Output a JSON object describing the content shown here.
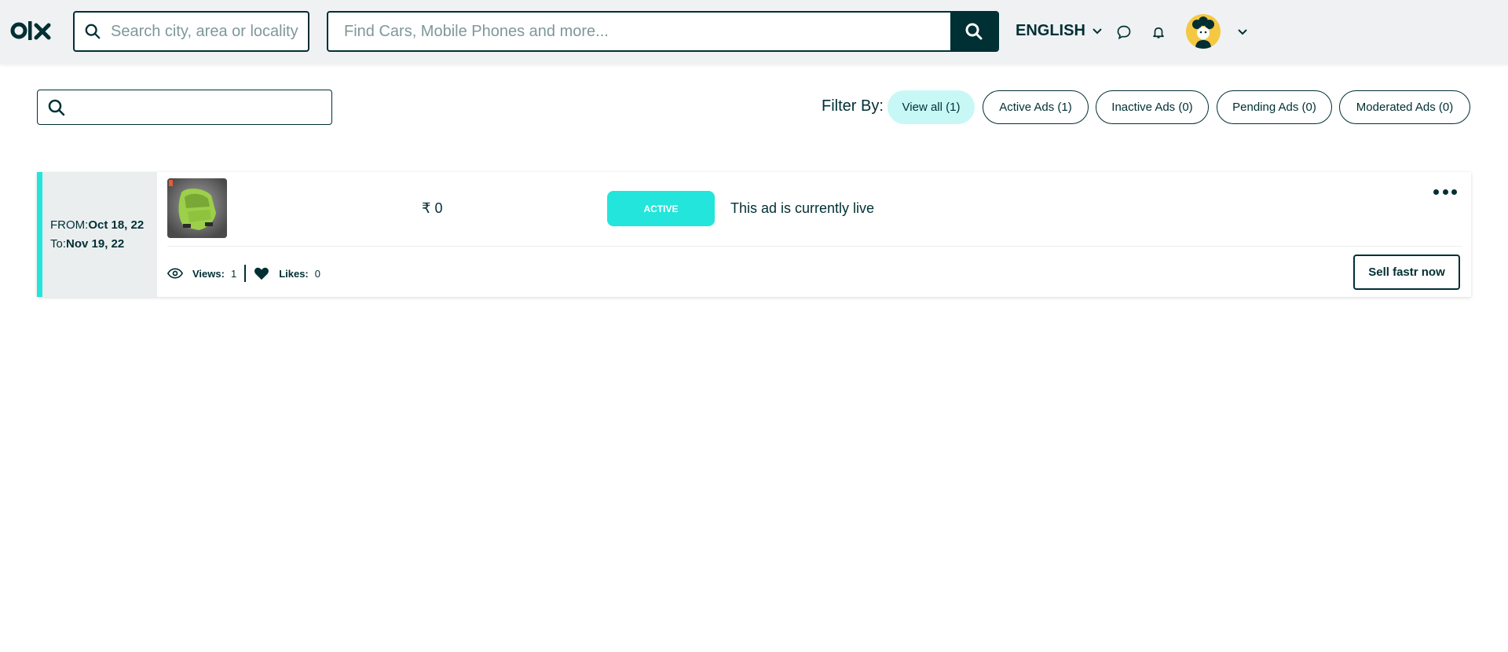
{
  "header": {
    "logo_text": "OLX",
    "location_placeholder": "Search city, area or locality",
    "search_placeholder": "Find Cars, Mobile Phones and more...",
    "language": "ENGLISH",
    "icons": [
      "search-icon",
      "chat-icon",
      "bell-icon",
      "chevron-down-icon"
    ]
  },
  "toolbar": {
    "search_placeholder": "",
    "filter_label": "Filter By:",
    "filters": [
      {
        "label": "View all (1)",
        "active": true
      },
      {
        "label": "Active Ads (1)",
        "active": false
      },
      {
        "label": "Inactive Ads (0)",
        "active": false
      },
      {
        "label": "Pending Ads (0)",
        "active": false
      },
      {
        "label": "Moderated Ads (0)",
        "active": false
      }
    ]
  },
  "ad": {
    "from_label": "FROM:",
    "from_date": "Oct 18, 22",
    "to_label": "To:",
    "to_date": "Nov 19, 22",
    "price": "₹ 0",
    "status": "ACTIVE",
    "status_text": "This ad is currently live",
    "views_label": "Views:",
    "views": "1",
    "likes_label": "Likes:",
    "likes": "0",
    "sell_button": "Sell fastr now"
  },
  "colors": {
    "brand_dark": "#002f34",
    "accent": "#23e5db",
    "header_bg": "#eff1f3",
    "chip_active": "#c8f8f6"
  }
}
